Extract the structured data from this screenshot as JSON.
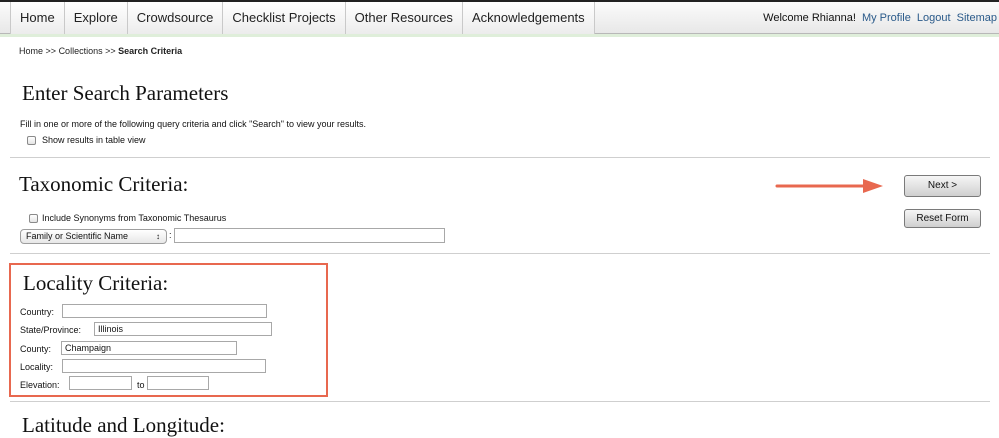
{
  "nav": {
    "tabs": [
      "Home",
      "Explore",
      "Crowdsource",
      "Checklist Projects",
      "Other Resources",
      "Acknowledgements"
    ],
    "welcome": "Welcome Rhianna!",
    "my_profile": "My Profile",
    "logout": "Logout",
    "sitemap": "Sitemap"
  },
  "breadcrumb": {
    "home": "Home",
    "sep1": ">>",
    "collections": "Collections",
    "sep2": ">>",
    "current": "Search Criteria"
  },
  "search": {
    "title": "Enter Search Parameters",
    "instructions": "Fill in one or more of the following query criteria and click \"Search\" to view your results.",
    "table_view_label": "Show results in table view",
    "table_view_checked": false
  },
  "taxonomic": {
    "title": "Taxonomic Criteria:",
    "synonyms_label": "Include Synonyms from Taxonomic Thesaurus",
    "synonyms_checked": false,
    "type_selected": "Family or Scientific Name",
    "type_caret": "↕",
    "colon": ":",
    "taxon_value": ""
  },
  "buttons": {
    "next": "Next >",
    "reset": "Reset Form"
  },
  "annotation": {
    "arrow_color": "#e8684f",
    "box_color": "#e8684f"
  },
  "locality": {
    "title": "Locality Criteria:",
    "country_label": "Country:",
    "country_value": "",
    "state_label": "State/Province:",
    "state_value": "Illinois",
    "county_label": "County:",
    "county_value": "Champaign",
    "locality_label": "Locality:",
    "locality_value": "",
    "elevation_label": "Elevation:",
    "elevation_from": "",
    "elevation_to_label": "to",
    "elevation_to": ""
  },
  "latlong": {
    "title": "Latitude and Longitude:"
  }
}
